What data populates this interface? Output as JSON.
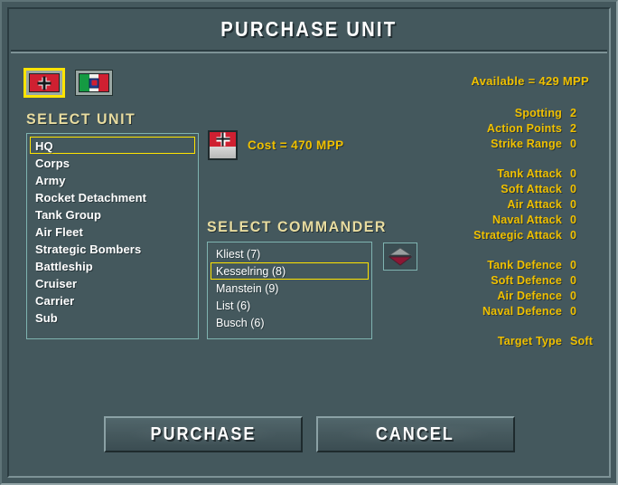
{
  "window": {
    "title": "PURCHASE UNIT"
  },
  "factions": [
    {
      "name": "germany",
      "label": "Germany",
      "selected": true
    },
    {
      "name": "italy",
      "label": "Italy",
      "selected": false
    }
  ],
  "resources": {
    "available_label": "Available = 429 MPP",
    "available_value": 429,
    "currency": "MPP"
  },
  "unit_panel": {
    "heading": "SELECT UNIT",
    "items": [
      {
        "label": "HQ",
        "selected": true
      },
      {
        "label": "Corps",
        "selected": false
      },
      {
        "label": "Army",
        "selected": false
      },
      {
        "label": "Rocket Detachment",
        "selected": false
      },
      {
        "label": "Tank Group",
        "selected": false
      },
      {
        "label": "Air Fleet",
        "selected": false
      },
      {
        "label": "Strategic Bombers",
        "selected": false
      },
      {
        "label": "Battleship",
        "selected": false
      },
      {
        "label": "Cruiser",
        "selected": false
      },
      {
        "label": "Carrier",
        "selected": false
      },
      {
        "label": "Sub",
        "selected": false
      }
    ]
  },
  "cost": {
    "text": "Cost =  470 MPP",
    "value": 470,
    "icon": "german-hq-unit-icon"
  },
  "commander_panel": {
    "heading": "SELECT COMMANDER",
    "emblem_icon": "commander-emblem-icon",
    "items": [
      {
        "label": "Kliest (7)",
        "selected": false
      },
      {
        "label": "Kesselring (8)",
        "selected": true
      },
      {
        "label": "Manstein (9)",
        "selected": false
      },
      {
        "label": "List (6)",
        "selected": false
      },
      {
        "label": "Busch (6)",
        "selected": false
      }
    ]
  },
  "stats": {
    "groups": [
      [
        {
          "label": "Spotting",
          "value": "2"
        },
        {
          "label": "Action Points",
          "value": "2"
        },
        {
          "label": "Strike Range",
          "value": "0"
        }
      ],
      [
        {
          "label": "Tank Attack",
          "value": "0"
        },
        {
          "label": "Soft Attack",
          "value": "0"
        },
        {
          "label": "Air Attack",
          "value": "0"
        },
        {
          "label": "Naval Attack",
          "value": "0"
        },
        {
          "label": "Strategic Attack",
          "value": "0"
        }
      ],
      [
        {
          "label": "Tank Defence",
          "value": "0"
        },
        {
          "label": "Soft Defence",
          "value": "0"
        },
        {
          "label": "Air Defence",
          "value": "0"
        },
        {
          "label": "Naval Defence",
          "value": "0"
        }
      ],
      [
        {
          "label": "Target Type",
          "value": "Soft"
        }
      ]
    ]
  },
  "actions": {
    "purchase_label": "PURCHASE",
    "cancel_label": "CANCEL"
  },
  "colors": {
    "background": "#44585d",
    "accent_yellow": "#f0c000",
    "heading_cream": "#e8dca0",
    "selection": "#ffe400",
    "list_border": "#7fb3b0"
  }
}
